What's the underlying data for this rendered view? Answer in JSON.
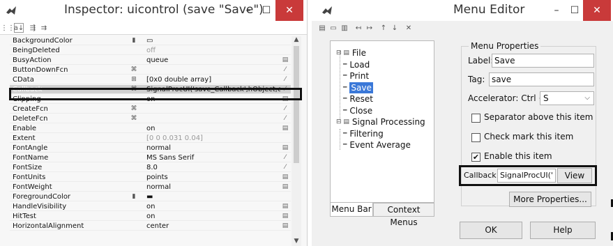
{
  "inspector": {
    "title": "Inspector:  uicontrol (save \"Save\")",
    "icon": "matlab-logo-icon",
    "window_controls": {
      "minimize": "–",
      "maximize": "☐",
      "close": "✕"
    },
    "toolbar": {
      "sort_category": "⋮⋮",
      "sort_alpha": "a↓",
      "expand": "⇶",
      "collapse": "⇉"
    },
    "properties": [
      {
        "name": "BackgroundColor",
        "button": "▮",
        "value": "▭",
        "edit": "",
        "expandable": true
      },
      {
        "name": "BeingDeleted",
        "button": "",
        "value": "off",
        "edit": "",
        "grey": true
      },
      {
        "name": "BusyAction",
        "button": "",
        "value": "queue",
        "edit": "▤"
      },
      {
        "name": "ButtonDownFcn",
        "button": "⌘",
        "value": "",
        "edit": "⁄"
      },
      {
        "name": "CData",
        "button": "⊞",
        "value": "[0x0  double array]",
        "edit": "⁄"
      },
      {
        "name": "Callback",
        "button": "⌘",
        "value": "SignalProcUI('save_Callback',hObject,even",
        "edit": "⁄",
        "selected": true
      },
      {
        "name": "Clipping",
        "button": "",
        "value": "on",
        "edit": "▤"
      },
      {
        "name": "CreateFcn",
        "button": "⌘",
        "value": "",
        "edit": "⁄"
      },
      {
        "name": "DeleteFcn",
        "button": "⌘",
        "value": "",
        "edit": "⁄"
      },
      {
        "name": "Enable",
        "button": "",
        "value": "on",
        "edit": "▤"
      },
      {
        "name": "Extent",
        "button": "",
        "value": "[0 0 0.031 0.04]",
        "edit": "",
        "grey": true,
        "expandable": true
      },
      {
        "name": "FontAngle",
        "button": "",
        "value": "normal",
        "edit": "▤"
      },
      {
        "name": "FontName",
        "button": "",
        "value": "MS Sans Serif",
        "edit": "⁄"
      },
      {
        "name": "FontSize",
        "button": "",
        "value": "8.0",
        "edit": "⁄"
      },
      {
        "name": "FontUnits",
        "button": "",
        "value": "points",
        "edit": "▤"
      },
      {
        "name": "FontWeight",
        "button": "",
        "value": "normal",
        "edit": "▤"
      },
      {
        "name": "ForegroundColor",
        "button": "▮",
        "value": "▬",
        "edit": "",
        "expandable": true
      },
      {
        "name": "HandleVisibility",
        "button": "",
        "value": "on",
        "edit": "▤"
      },
      {
        "name": "HitTest",
        "button": "",
        "value": "on",
        "edit": "▤"
      },
      {
        "name": "HorizontalAlignment",
        "button": "",
        "value": "center",
        "edit": "▤"
      }
    ]
  },
  "menu_editor": {
    "title": "Menu Editor",
    "window_controls": {
      "minimize": "–",
      "maximize": "☐",
      "close": "✕"
    },
    "toolbar": {
      "new_menu": "▤",
      "new_item": "▭",
      "new_context": "▥",
      "outdent": "↤",
      "indent": "↦",
      "move_up": "↑",
      "move_down": "↓",
      "delete": "✕"
    },
    "tree": [
      {
        "label": "File",
        "level": 0,
        "expander": "⊟"
      },
      {
        "label": "Load",
        "level": 1
      },
      {
        "label": "Print",
        "level": 1
      },
      {
        "label": "Save",
        "level": 1,
        "selected": true
      },
      {
        "label": "Reset",
        "level": 1
      },
      {
        "label": "Close",
        "level": 1
      },
      {
        "label": "Signal Processing",
        "level": 0,
        "expander": "⊟"
      },
      {
        "label": "Filtering",
        "level": 1
      },
      {
        "label": "Event Average",
        "level": 1
      }
    ],
    "tabs": [
      "Menu Bar",
      "Context Menus"
    ],
    "properties": {
      "group_title": "Menu Properties",
      "label_caption": "Label:",
      "label_value": "Save",
      "tag_caption": "Tag:",
      "tag_value": "save",
      "accelerator_caption": "Accelerator: Ctrl +",
      "accelerator_value": "S",
      "separator_label": "Separator above this item",
      "separator_checked": false,
      "checkmark_label": "Check mark this item",
      "checkmark_checked": false,
      "enable_label": "Enable this item",
      "enable_checked": true,
      "callback_caption": "Callback",
      "callback_value": "SignalProcUI('",
      "view_button": "View",
      "more_button": "More Properties...",
      "ok_button": "OK",
      "help_button": "Help"
    }
  }
}
